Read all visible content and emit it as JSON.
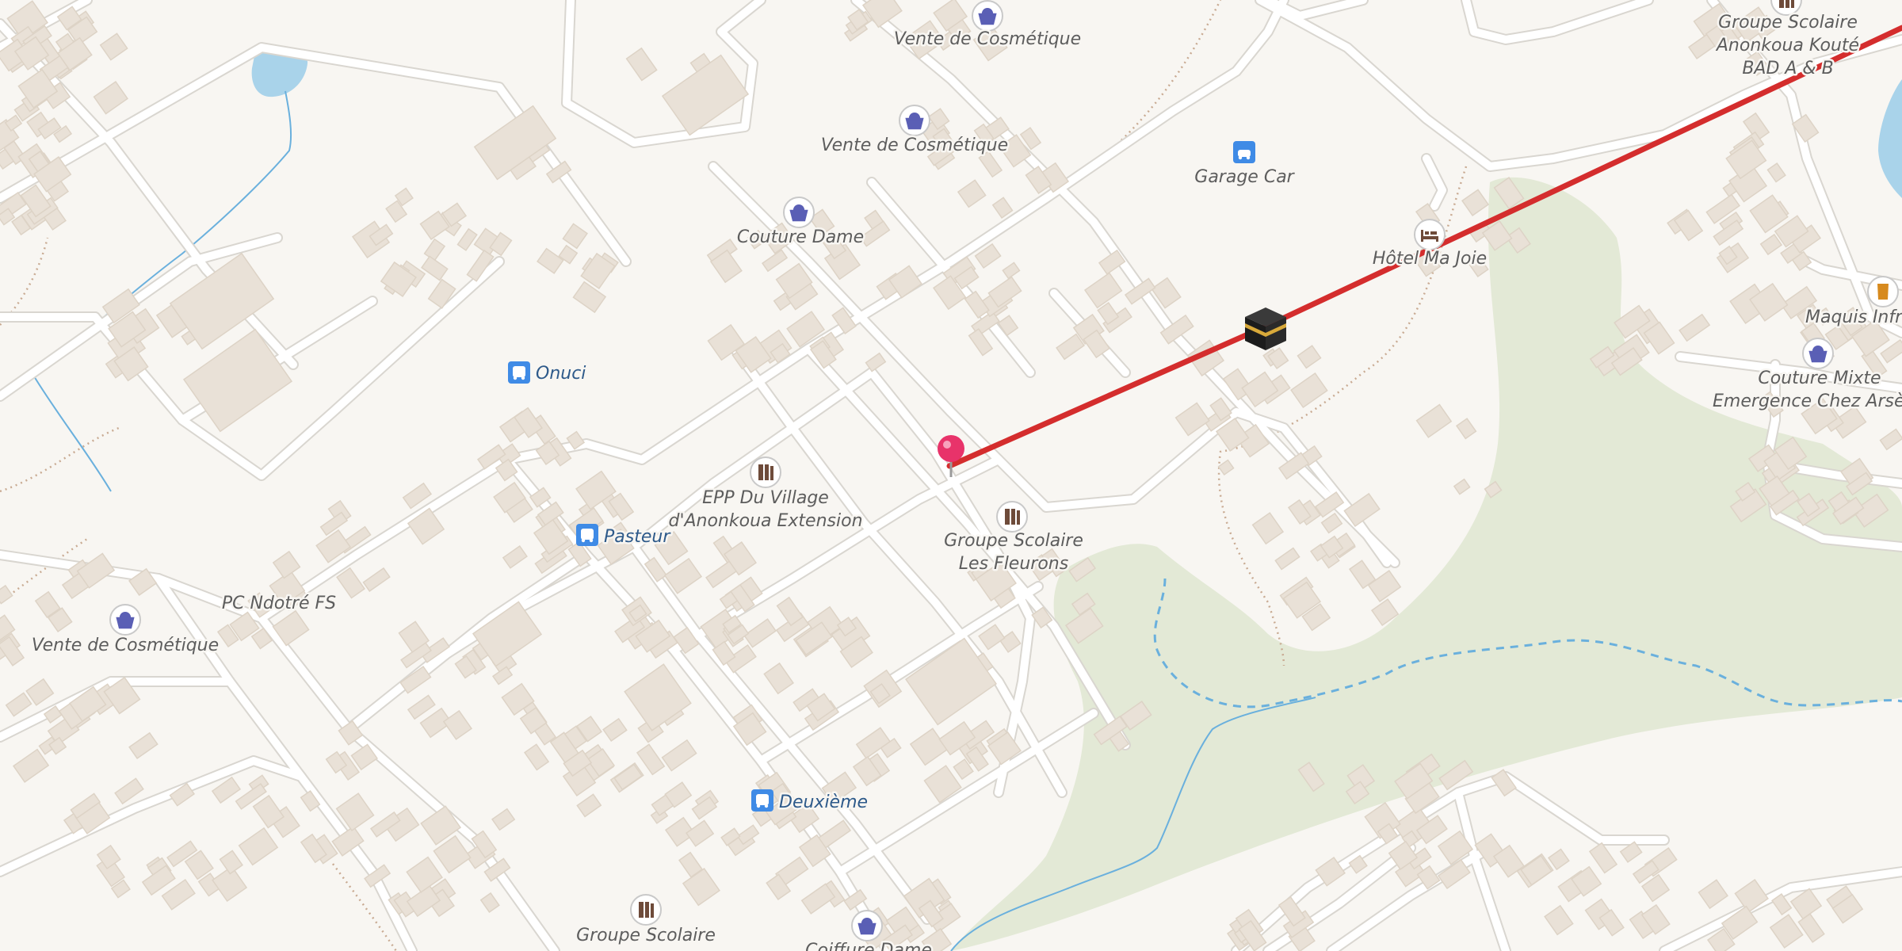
{
  "map": {
    "colors": {
      "background": "#f8f6f2",
      "road": "#ffffff",
      "road_casing": "#d9d6d0",
      "building": "#e9e1d7",
      "building_stroke": "#ddd3c6",
      "park": "#e3e9d6",
      "water": "#a9d3ea",
      "stream": "#6ab0dd",
      "route": "#d42d2d",
      "pin": "#e8336a",
      "shop_icon": "#5a5fb5",
      "transit_icon": "#3f8be6"
    },
    "pois": [
      {
        "id": "vente1",
        "lines": [
          "Vente de Cosmétique"
        ],
        "icon": "shopping-basket-icon"
      },
      {
        "id": "vente2",
        "lines": [
          "Vente de Cosmétique"
        ],
        "icon": "shopping-basket-icon"
      },
      {
        "id": "couture1",
        "lines": [
          "Couture Dame"
        ],
        "icon": "shopping-basket-icon"
      },
      {
        "id": "garage",
        "lines": [
          "Garage Car"
        ],
        "icon": "car-icon"
      },
      {
        "id": "hotel",
        "lines": [
          "Hôtel Ma Joie"
        ],
        "icon": "bed-icon"
      },
      {
        "id": "groupe_top",
        "lines": [
          "Groupe Scolaire",
          "Anonkoua Kouté",
          "BAD A & B"
        ],
        "icon": "school-icon"
      },
      {
        "id": "maquis",
        "lines": [
          "Maquis Infro"
        ],
        "icon": "drink-icon"
      },
      {
        "id": "couture2",
        "lines": [
          "Couture Mixte",
          "Emergence Chez Arsène"
        ],
        "icon": "shopping-basket-icon"
      },
      {
        "id": "onuci",
        "lines": [
          "Onuci"
        ],
        "icon": "bus-stop-icon"
      },
      {
        "id": "epp",
        "lines": [
          "EPP Du Village",
          "d'Anonkoua Extension"
        ],
        "icon": "school-icon"
      },
      {
        "id": "pasteur",
        "lines": [
          "Pasteur"
        ],
        "icon": "bus-stop-icon"
      },
      {
        "id": "fleurons",
        "lines": [
          "Groupe Scolaire",
          "Les Fleurons"
        ],
        "icon": "school-icon"
      },
      {
        "id": "pc",
        "lines": [
          "PC Ndotré FS"
        ],
        "icon": ""
      },
      {
        "id": "vente3",
        "lines": [
          "Vente de Cosmétique"
        ],
        "icon": "shopping-basket-icon"
      },
      {
        "id": "deuxieme",
        "lines": [
          "Deuxième"
        ],
        "icon": "bus-stop-icon"
      },
      {
        "id": "groupe_bottom",
        "lines": [
          "Groupe Scolaire"
        ],
        "icon": "school-icon"
      },
      {
        "id": "coiffure",
        "lines": [
          "Coiffure Dame"
        ],
        "icon": "shopping-basket-icon"
      }
    ],
    "markers": {
      "pin": "location-pin-icon",
      "destination": "kaaba-icon"
    }
  }
}
